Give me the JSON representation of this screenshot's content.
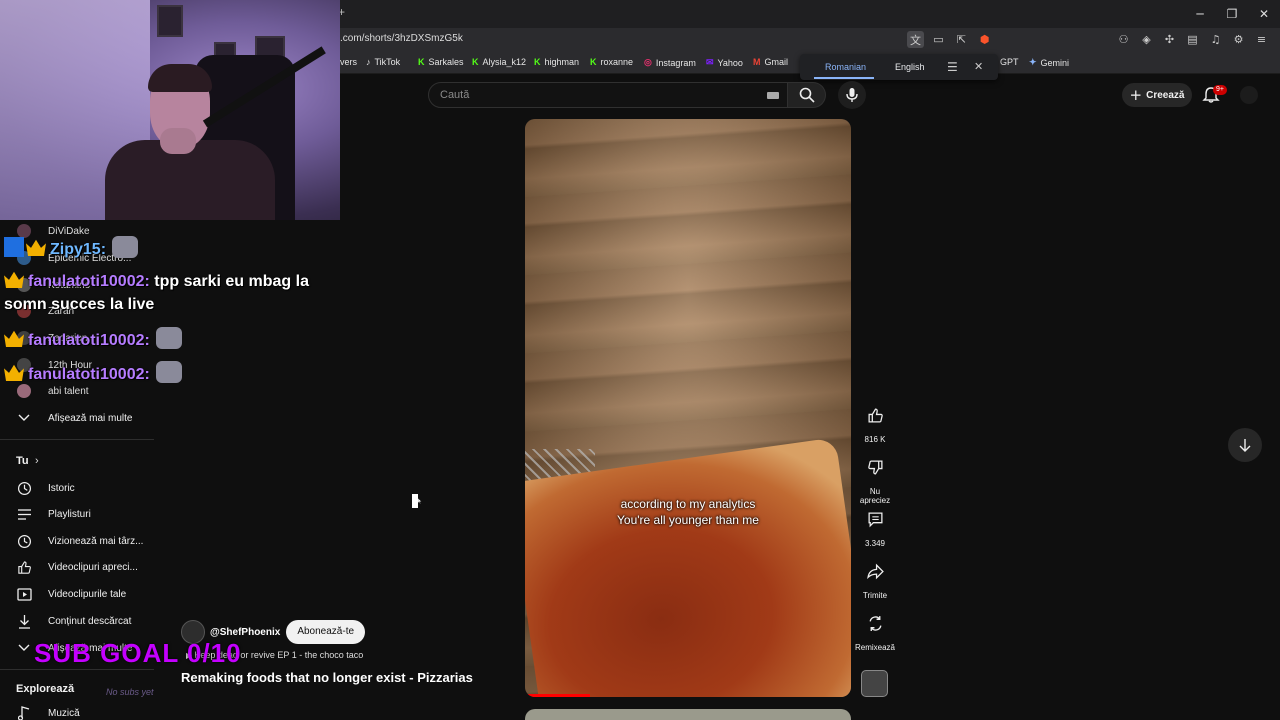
{
  "browser": {
    "url": ".com/shorts/3hzDXSmzG5k",
    "window_controls": [
      "minimize",
      "restore",
      "close"
    ],
    "bookmarks": [
      {
        "label": "vers",
        "icon": ""
      },
      {
        "label": "TikTok",
        "icon": "tiktok-icon"
      },
      {
        "label": "Sarkales",
        "icon": "kick-icon"
      },
      {
        "label": "Alysia_k12",
        "icon": "kick-icon"
      },
      {
        "label": "highman",
        "icon": "kick-icon"
      },
      {
        "label": "roxanne",
        "icon": "kick-icon"
      },
      {
        "label": "Instagram",
        "icon": "instagram-icon"
      },
      {
        "label": "Yahoo",
        "icon": "yahoo-icon"
      },
      {
        "label": "Gmail",
        "icon": "gmail-icon"
      },
      {
        "label": "GPT",
        "icon": ""
      },
      {
        "label": "Gemini",
        "icon": "gemini-icon"
      }
    ],
    "translate_popup": {
      "tab1": "Romanian",
      "tab2": "English"
    }
  },
  "header": {
    "search_placeholder": "Caută",
    "create_label": "Creează",
    "notifications_badge": "9+"
  },
  "sidebar": {
    "subscriptions": [
      "DiViDake",
      "Epidemic Electro...",
      "Ketamino",
      "Zarah",
      "Zadarion",
      "12th Hour",
      "abi talent"
    ],
    "show_more": "Afișează mai multe",
    "you_title": "Tu",
    "you_items": [
      "Istoric",
      "Playlisturi",
      "Vizionează mai târz...",
      "Videoclipuri apreci...",
      "Videoclipurile tale",
      "Conținut descărcat",
      "Afișează mai multe"
    ],
    "explore_title": "Explorează",
    "explore_items": [
      "Muzică"
    ]
  },
  "chat": {
    "lines": [
      {
        "user": "Zipy15:",
        "message": ""
      },
      {
        "user": "fanulatoti10002:",
        "message": "tpp sarki eu mbag la"
      },
      {
        "continuation": "somn succes la live"
      },
      {
        "user": "fanulatoti10002:",
        "message": ""
      },
      {
        "user": "fanulatoti10002:",
        "message": ""
      }
    ],
    "sub_goal": "SUB GOAL 0/10",
    "no_subs": "No subs yet"
  },
  "short": {
    "subtitle_line1": "according to my analytics",
    "subtitle_line2": "You're all younger than me",
    "channel": "@ShefPhoenix",
    "subscribe_label": "Abonează-te",
    "playlist": "Keep dead or revive EP 1 - the choco taco",
    "title": "Remaking foods that no longer exist - Pizzarias",
    "progress_fraction": 0.2
  },
  "actions": {
    "like_count": "816 K",
    "dislike_label": "Nu apreciez",
    "comments_count": "3.349",
    "share_label": "Trimite",
    "remix_label": "Remixează"
  },
  "colors": {
    "background": "#0f0f0f",
    "accent_red": "#ff0000",
    "chat_username": "#b57cff",
    "sub_goal": "#c400ff"
  }
}
